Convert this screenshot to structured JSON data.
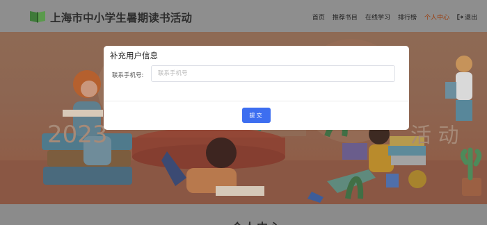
{
  "header": {
    "title": "上海市中小学生暑期读书活动",
    "nav": [
      {
        "label": "首页"
      },
      {
        "label": "推荐书目"
      },
      {
        "label": "在线学习"
      },
      {
        "label": "排行榜"
      },
      {
        "label": "个人中心",
        "active": true
      },
      {
        "label": "退出",
        "icon": "logout-icon"
      }
    ]
  },
  "banner": {
    "text_left": "2023",
    "text_right": "活 动"
  },
  "modal": {
    "title": "补充用户信息",
    "phone_label": "联系手机号:",
    "phone_value": "",
    "phone_placeholder": "联系手机号",
    "submit_label": "提交"
  },
  "page": {
    "section_heading": "个人中心"
  },
  "colors": {
    "overlay": "#9a9a9a",
    "accent": "#3d6ef0",
    "active_nav": "#9a3e0e"
  }
}
